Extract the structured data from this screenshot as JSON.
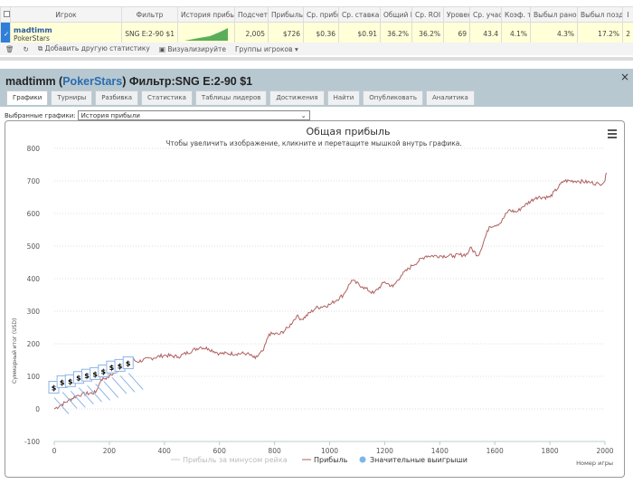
{
  "table": {
    "headers": [
      "",
      "Игрок",
      "Фильтр",
      "История прибы",
      "Подсчет",
      "Прибыль",
      "Ср. прибы",
      "Ср. ставка",
      "Общий R",
      "Ср. ROI",
      "Уровен",
      "Ср. учас",
      "Коэф. т",
      "Выбыл рано",
      "Выбыл позд",
      "I"
    ],
    "row": {
      "player": "madtimm",
      "site": "PokerStars",
      "filter": "SNG E:2-90 $1",
      "count": "2,005",
      "profit": "$726",
      "avg_profit": "$0.36",
      "avg_stake": "$0.91",
      "total_roi": "36.2%",
      "avg_roi": "36.2%",
      "level": "69",
      "avg_entrants": "43.4",
      "coef": "4.1%",
      "early": "4.3%",
      "late": "17.2%",
      "extra": "2"
    }
  },
  "toolbar": {
    "add_stat": "Добавить другую статистику",
    "visualize": "Визуализируйте",
    "groups": "Группы игроков"
  },
  "panel": {
    "player": "madtimm",
    "open": " (",
    "site": "PokerStars",
    "close": ")",
    "filter": " Фильтр:SNG E:2-90 $1",
    "close_icon": "×"
  },
  "tabs": [
    "Графики",
    "Турниры",
    "Разбивка",
    "Статистика",
    "Таблицы лидеров",
    "Достижения",
    "Найти",
    "Опубликовать",
    "Аналитика"
  ],
  "selected_label": "Выбранные графики:",
  "selected_value": "История прибыли",
  "chart_data": {
    "type": "line",
    "title": "Общая прибыль",
    "subtitle": "Чтобы увеличить изображение, кликните и перетащите мышкой внутрь графика.",
    "xlabel": "Номер игры",
    "ylabel": "Суммарный итог (USD)",
    "xlim": [
      0,
      2005
    ],
    "ylim": [
      -100,
      800
    ],
    "xticks": [
      0,
      200,
      400,
      600,
      800,
      1000,
      1200,
      1400,
      1600,
      1800,
      2000
    ],
    "yticks": [
      -100,
      0,
      100,
      200,
      300,
      400,
      500,
      600,
      700,
      800
    ],
    "legend": [
      "Прибыль за минусом рейка",
      "Прибыль",
      "Значительные выигрыши"
    ],
    "legend_placement": "bottom",
    "series": [
      {
        "name": "Прибыль",
        "color": "#b06060",
        "x": [
          0,
          20,
          50,
          80,
          100,
          150,
          170,
          200,
          250,
          280,
          300,
          400,
          450,
          530,
          560,
          600,
          700,
          730,
          760,
          780,
          820,
          850,
          880,
          900,
          950,
          1000,
          1050,
          1080,
          1120,
          1160,
          1200,
          1230,
          1260,
          1300,
          1350,
          1400,
          1450,
          1500,
          1510,
          1540,
          1580,
          1620,
          1650,
          1680,
          1700,
          1750,
          1800,
          1850,
          1900,
          1950,
          1980,
          2000,
          2005
        ],
        "y": [
          0,
          10,
          25,
          40,
          45,
          50,
          90,
          100,
          130,
          155,
          145,
          165,
          160,
          190,
          185,
          170,
          170,
          155,
          180,
          230,
          230,
          250,
          285,
          275,
          310,
          320,
          350,
          395,
          375,
          355,
          390,
          375,
          410,
          440,
          470,
          470,
          470,
          475,
          495,
          470,
          560,
          570,
          610,
          605,
          620,
          650,
          650,
          700,
          700,
          695,
          690,
          700,
          725
        ]
      }
    ],
    "big_wins": {
      "marker": "$",
      "x": [
        0,
        30,
        60,
        90,
        120,
        150,
        180,
        210,
        240,
        270
      ],
      "y": [
        68,
        85,
        88,
        98,
        105,
        110,
        118,
        130,
        135,
        143
      ]
    }
  }
}
